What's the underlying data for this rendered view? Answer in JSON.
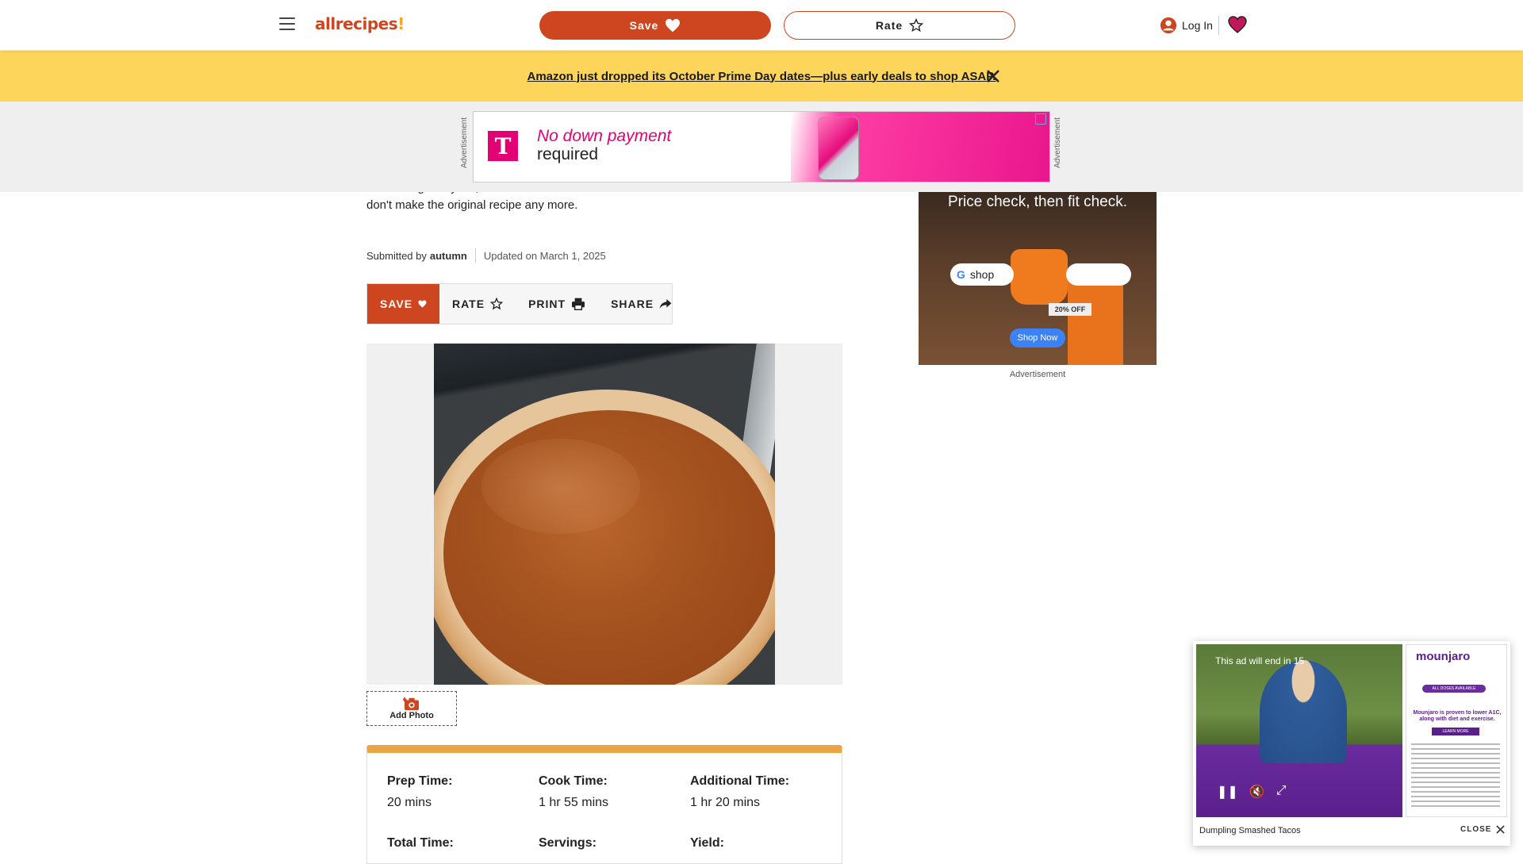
{
  "header": {
    "logo_text": "allrecipes",
    "logo_bang": "!",
    "save_label": "Save",
    "rate_label": "Rate",
    "login_label": "Log In"
  },
  "promo": {
    "text": "Amazon just dropped its October Prime Day dates—plus early deals to shop ASAP."
  },
  "top_ad": {
    "side_label": "Advertisement",
    "brand_mark": "T",
    "headline": "No down payment",
    "subline": "required"
  },
  "recipe": {
    "intro": "I'm not vegan myself, but I made this variant for some friends and loved it so much that I don't make the original recipe any more.",
    "submitted_by_prefix": "Submitted by",
    "author": "autumn",
    "updated": "Updated on March 1, 2025",
    "actions": {
      "save": "SAVE",
      "rate": "RATE",
      "print": "PRINT",
      "share": "SHARE"
    },
    "add_photo_label": "Add Photo",
    "details": [
      {
        "label": "Prep Time:",
        "value": "20 mins"
      },
      {
        "label": "Cook Time:",
        "value": "1 hr 55 mins"
      },
      {
        "label": "Additional Time:",
        "value": "1 hr 20 mins"
      },
      {
        "label": "Total Time:",
        "value": ""
      },
      {
        "label": "Servings:",
        "value": ""
      },
      {
        "label": "Yield:",
        "value": ""
      }
    ]
  },
  "side_ad": {
    "headline": "Price check, then fit check.",
    "shop_label": "shop",
    "discount": "20% OFF",
    "cta": "Shop Now",
    "label": "Advertisement"
  },
  "video_ad": {
    "countdown": "This ad will end in 15",
    "brand": "mounjaro",
    "badge": "ALL DOSES AVAILABLE",
    "claim": "Mounjaro is proven to lower A1C, along with diet and exercise.",
    "cta": "LEARN MORE",
    "caption": "Dumpling Smashed Tacos",
    "close_label": "CLOSE"
  },
  "colors": {
    "brand": "#ce4620",
    "promo_bg": "#fcd55a",
    "details_accent": "#eaa446",
    "tmobile": "#e20074"
  }
}
